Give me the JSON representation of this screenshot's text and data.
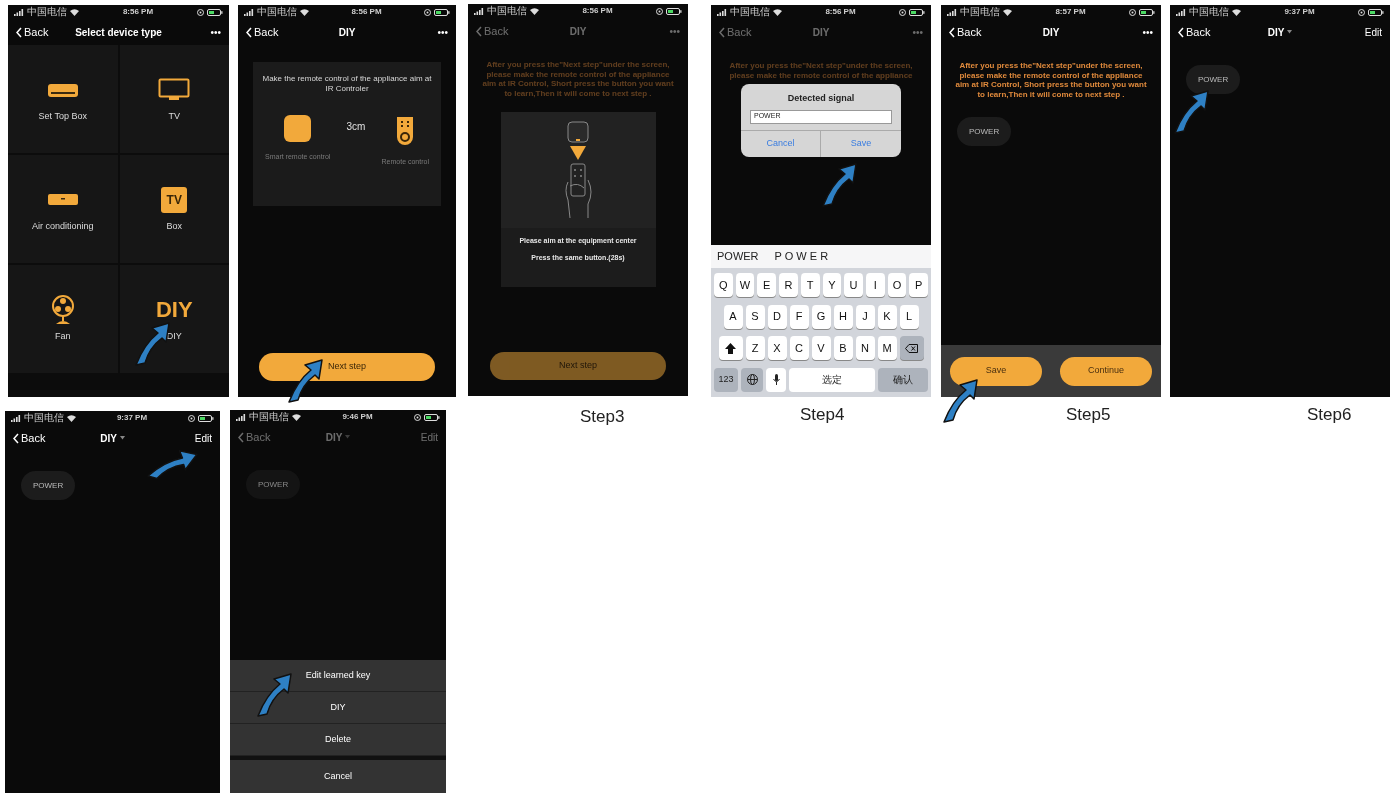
{
  "screens": [
    {
      "status": {
        "carrier": "中国电信",
        "time": "8:56 PM"
      },
      "nav": {
        "back": "Back",
        "title": "Select device type",
        "dropdown": false,
        "action": "•••"
      },
      "dimmed": false,
      "tiles": [
        {
          "kind": "pictogram",
          "label": "Set Top Box"
        },
        {
          "kind": "pictogram",
          "label": "TV"
        },
        {
          "kind": "pictogram",
          "label": "Air conditioning"
        },
        {
          "kind": "badge",
          "label": "Box"
        },
        {
          "kind": "pictogram",
          "label": "Fan"
        },
        {
          "kind": "wordmark",
          "label": "DIY"
        }
      ],
      "tile_icon_texts": [
        "TV",
        "DIY"
      ]
    },
    {
      "status": {
        "carrier": "中国电信",
        "time": "8:56 PM"
      },
      "nav": {
        "back": "Back",
        "title": "DIY",
        "dropdown": false,
        "action": "•••"
      },
      "dimmed": false,
      "card": {
        "text": "Make the remote control of the appliance aim at IR Controler",
        "distance": "3cm",
        "left_label": "Smart remote control",
        "right_label": "Remote control"
      },
      "primary_button": "Next step"
    },
    {
      "status": {
        "carrier": "中国电信",
        "time": "8:56 PM"
      },
      "nav": {
        "back": "Back",
        "title": "DIY",
        "dropdown": false,
        "action": "•••"
      },
      "dimmed": true,
      "instruction": "After you press the\"Next step\"under the screen, please make the remote control of the appliance aim at IR Control, Short press the button you want to learn,Then it  will come to next step .",
      "panel": {
        "lines": [
          "Please aim at the equipment center",
          "Press the same button.(28s)"
        ]
      },
      "primary_button": "Next step",
      "caption": "Step3"
    },
    {
      "status": {
        "carrier": "中国电信",
        "time": "8:56 PM"
      },
      "nav": {
        "back": "Back",
        "title": "DIY",
        "dropdown": false,
        "action": "•••"
      },
      "dimmed": true,
      "instruction": "After you press the\"Next step\"under the screen, please make the remote control of the appliance",
      "dialog": {
        "title": "Detected signal",
        "value": "POWER",
        "cancel": "Cancel",
        "confirm": "Save"
      },
      "keyboard": {
        "suggestions": [
          "POWER",
          "P O W E R"
        ],
        "rows": [
          [
            "Q",
            "W",
            "E",
            "R",
            "T",
            "Y",
            "U",
            "I",
            "O",
            "P"
          ],
          [
            "A",
            "S",
            "D",
            "F",
            "G",
            "H",
            "J",
            "K",
            "L"
          ],
          [
            "Z",
            "X",
            "C",
            "V",
            "B",
            "N",
            "M"
          ]
        ],
        "numbers": "123",
        "space": "选定",
        "return": "确认"
      },
      "caption": "Step4"
    },
    {
      "status": {
        "carrier": "中国电信",
        "time": "8:57 PM"
      },
      "nav": {
        "back": "Back",
        "title": "DIY",
        "dropdown": false,
        "action": "•••"
      },
      "dimmed": false,
      "instruction": "After you press the\"Next step\"under the screen, please make the remote control of the appliance aim at IR Control, Short press the button you want to learn,Then it  will come to next step .",
      "keys": [
        "POWER"
      ],
      "footer_buttons": [
        "Save",
        "Continue"
      ],
      "caption": "Step5"
    },
    {
      "status": {
        "carrier": "中国电信",
        "time": "9:37 PM"
      },
      "nav": {
        "back": "Back",
        "title": "DIY",
        "dropdown": true,
        "action": "Edit"
      },
      "dimmed": false,
      "keys": [
        "POWER"
      ],
      "caption": "Step6"
    },
    {
      "status": {
        "carrier": "中国电信",
        "time": "9:37 PM"
      },
      "nav": {
        "back": "Back",
        "title": "DIY",
        "dropdown": true,
        "action": "Edit"
      },
      "dimmed": false,
      "keys": [
        "POWER"
      ]
    },
    {
      "status": {
        "carrier": "中国电信",
        "time": "9:46 PM"
      },
      "nav": {
        "back": "Back",
        "title": "DIY",
        "dropdown": true,
        "action": "Edit"
      },
      "dimmed": true,
      "keys": [
        "POWER"
      ],
      "sheet": {
        "items": [
          "Edit learned key",
          "DIY",
          "Delete"
        ],
        "cancel": "Cancel"
      }
    }
  ]
}
